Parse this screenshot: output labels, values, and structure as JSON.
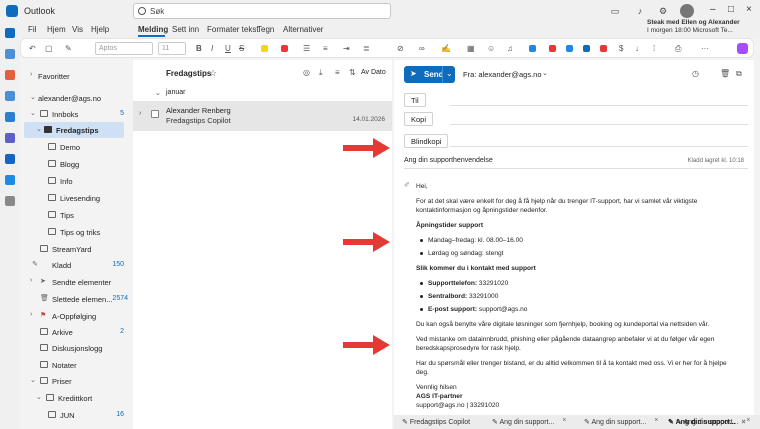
{
  "app": {
    "title": "Outlook"
  },
  "search": {
    "placeholder": "Søk"
  },
  "upcoming": {
    "line1": "Steak med Ellen og Alexander",
    "line2": "I morgen 18:00 Microsoft Te..."
  },
  "menu": {
    "items": [
      "Fil",
      "Hjem",
      "Vis",
      "Hjelp",
      "Melding",
      "Sett inn",
      "Formater tekst",
      "Tegn",
      "Alternativer"
    ],
    "active": "Melding"
  },
  "ribbon": {
    "font": "Aptos",
    "size": "11"
  },
  "folders": {
    "favorites": "Favoritter",
    "account": "alexander@ags.no",
    "items": [
      {
        "label": "Innboks",
        "count": "5"
      },
      {
        "label": "Fredagstips",
        "count": ""
      },
      {
        "label": "Demo",
        "count": ""
      },
      {
        "label": "Blogg",
        "count": ""
      },
      {
        "label": "Info",
        "count": ""
      },
      {
        "label": "Livesending",
        "count": ""
      },
      {
        "label": "Tips",
        "count": ""
      },
      {
        "label": "Tips og triks",
        "count": ""
      },
      {
        "label": "StreamYard",
        "count": ""
      },
      {
        "label": "Kladd",
        "count": "150"
      },
      {
        "label": "Sendte elementer",
        "count": ""
      },
      {
        "label": "Slettede elemen...",
        "count": "2574"
      },
      {
        "label": "A-Oppfølging",
        "count": ""
      },
      {
        "label": "Arkive",
        "count": "2"
      },
      {
        "label": "Diskusjonslogg",
        "count": ""
      },
      {
        "label": "Notater",
        "count": ""
      },
      {
        "label": "Priser",
        "count": ""
      },
      {
        "label": "Kredittkort",
        "count": ""
      },
      {
        "label": "JUN",
        "count": "16"
      }
    ]
  },
  "list": {
    "title": "Fredagstips",
    "sort": "Av Dato",
    "group": "januar",
    "message": {
      "from": "Alexander Renberg",
      "subject": "Fredagstips Copilot",
      "date": "14.01.2026"
    }
  },
  "compose": {
    "send": "Send",
    "from": "Fra: alexander@ags.no",
    "to": "Til",
    "cc": "Kopi",
    "bcc": "Blindkopi",
    "subject": "Ang din supporthenvendelse",
    "saved": "Kladd lagret kl. 10:18",
    "body": {
      "greeting": "Hei,",
      "intro": "For at det skal være enkelt for deg å få hjelp når du trenger IT-support, har vi samlet vår viktigste kontaktinformasjon og åpningstider nedenfor.",
      "hours_heading": "Åpningstider support",
      "hours": [
        "Mandag–fredag: kl. 08.00–16.00",
        "Lørdag og søndag: stengt"
      ],
      "contact_heading": "Slik kommer du i kontakt med support",
      "contact": [
        {
          "label": "Supporttelefon:",
          "value": " 33291020"
        },
        {
          "label": "Sentralbord:",
          "value": " 33291000"
        },
        {
          "label": "E-post support:",
          "value": " support@ags.no"
        }
      ],
      "p1": "Du kan også benytte våre digitale løsninger som fjernhjelp, booking og kundeportal via nettsiden vår.",
      "p2": "Ved mistanke om datainnbrudd, phishing eller pågående dataangrep anbefaler vi at du følger vår egen beredskapsprosedyre for rask hjelp.",
      "p3": "Har du spørsmål eller trenger bistand, er du alltid velkommen til å ta kontakt med oss. Vi er her for å hjelpe deg.",
      "closing": "Vennlig hilsen",
      "company": "AGS IT-partner",
      "signature": "support@ags.no | 33291020"
    }
  },
  "tabs": [
    "Fredagstips Copilot",
    "Ang din support...",
    "Ang din support...",
    "Ang din support...",
    "Ang din support..."
  ],
  "colors": {
    "accent": "#0f6cbd",
    "arrow": "#e53935"
  }
}
